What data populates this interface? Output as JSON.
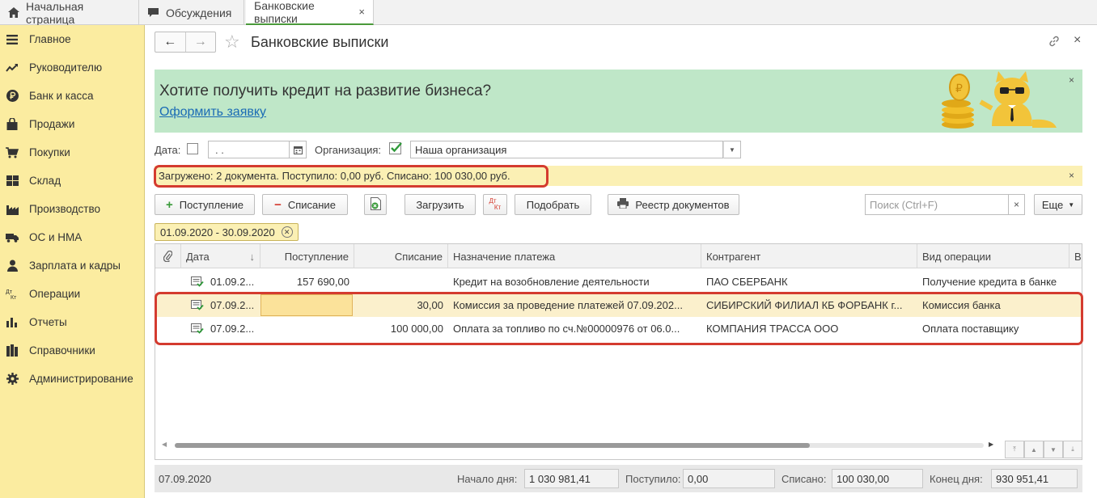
{
  "tabs": [
    {
      "label": "Начальная страница",
      "icon": "home-icon"
    },
    {
      "label": "Обсуждения",
      "icon": "chat-icon"
    },
    {
      "label": "Банковские выписки",
      "icon": "",
      "close": "×"
    }
  ],
  "sidebar": {
    "items": [
      {
        "label": "Главное",
        "icon": "menu-icon"
      },
      {
        "label": "Руководителю",
        "icon": "trend-icon"
      },
      {
        "label": "Банк и касса",
        "icon": "ruble-icon"
      },
      {
        "label": "Продажи",
        "icon": "bag-icon"
      },
      {
        "label": "Покупки",
        "icon": "cart-icon"
      },
      {
        "label": "Склад",
        "icon": "warehouse-icon"
      },
      {
        "label": "Производство",
        "icon": "factory-icon"
      },
      {
        "label": "ОС и НМА",
        "icon": "truck-icon"
      },
      {
        "label": "Зарплата и кадры",
        "icon": "person-icon"
      },
      {
        "label": "Операции",
        "icon": "dt-kt-icon"
      },
      {
        "label": "Отчеты",
        "icon": "bar-chart-icon"
      },
      {
        "label": "Справочники",
        "icon": "books-icon"
      },
      {
        "label": "Администрирование",
        "icon": "gear-icon"
      }
    ]
  },
  "header": {
    "title": "Банковские выписки",
    "back": "←",
    "forward": "→",
    "star": "☆",
    "close": "×"
  },
  "banner": {
    "title": "Хотите получить кредит на развитие бизнеса?",
    "link": "Оформить заявку",
    "close": "×"
  },
  "filters": {
    "date_label": "Дата:",
    "date_value": ". .",
    "org_label": "Организация:",
    "org_value": "Наша организация"
  },
  "status": {
    "text": "Загружено: 2 документа. Поступило: 0,00 руб. Списано: 100 030,00 руб.",
    "close": "×"
  },
  "toolbar": {
    "income": "Поступление",
    "expense": "Списание",
    "load": "Загрузить",
    "dtkt_top": "Дт",
    "dtkt_bottom": "Кт",
    "match": "Подобрать",
    "registry": "Реестр документов",
    "search_placeholder": "Поиск (Ctrl+F)",
    "clear": "×",
    "more": "Еще"
  },
  "period": {
    "label": "01.09.2020 - 30.09.2020"
  },
  "table": {
    "headers": [
      "Дата",
      "Поступление",
      "Списание",
      "Назначение платежа",
      "Контрагент",
      "Вид операции",
      "В"
    ],
    "sort_indicator": "↓",
    "rows": [
      {
        "date": "01.09.2...",
        "income": "157 690,00",
        "expense": "",
        "purpose": "Кредит на возобновление деятельности",
        "counterparty": "ПАО СБЕРБАНК",
        "operation": "Получение кредита в банке"
      },
      {
        "date": "07.09.2...",
        "income": "",
        "expense": "30,00",
        "purpose": "Комиссия за проведение платежей 07.09.202...",
        "counterparty": "СИБИРСКИЙ ФИЛИАЛ КБ ФОРБАНК г...",
        "operation": "Комиссия банка"
      },
      {
        "date": "07.09.2...",
        "income": "",
        "expense": "100 000,00",
        "purpose": "Оплата за топливо по сч.№00000976 от 06.0...",
        "counterparty": "КОМПАНИЯ ТРАССА ООО",
        "operation": "Оплата поставщику"
      }
    ]
  },
  "footer": {
    "date": "07.09.2020",
    "start_label": "Начало дня:",
    "start_value": "1 030 981,41",
    "in_label": "Поступило:",
    "in_value": "0,00",
    "out_label": "Списано:",
    "out_value": "100 030,00",
    "end_label": "Конец дня:",
    "end_value": "930 951,41"
  },
  "colors": {
    "sidebar_bg": "#fbeca0",
    "banner_bg": "#bfe7c8",
    "status_bg": "#fbf0b4",
    "highlight_red": "#d43b2f",
    "link": "#1a6bb5",
    "active_tab_underline": "#4a9a3a"
  }
}
